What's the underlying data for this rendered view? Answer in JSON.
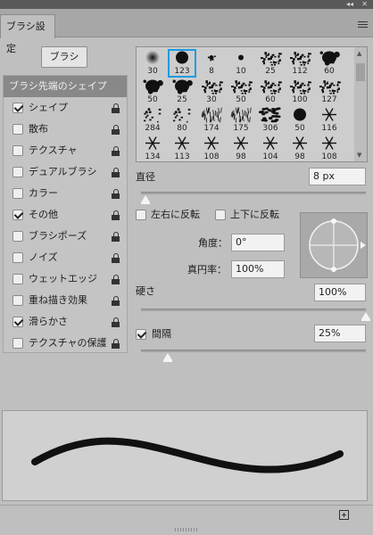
{
  "window": {
    "tab_title": "ブラシ設定",
    "collapse_glyph": "◂◂",
    "close_glyph": "✕"
  },
  "colors": {
    "panel_bg": "#bfbfbf",
    "header_bg": "#888888",
    "selection": "#1e9be0",
    "stroke": "#111111"
  },
  "preset_button": {
    "label": "ブラシ"
  },
  "options": {
    "header": "ブラシ先端のシェイプ",
    "items": [
      {
        "label": "シェイプ",
        "checked": true
      },
      {
        "label": "散布",
        "checked": false
      },
      {
        "label": "テクスチャ",
        "checked": false
      },
      {
        "label": "デュアルブラシ",
        "checked": false
      },
      {
        "label": "カラー",
        "checked": false
      },
      {
        "label": "その他",
        "checked": true
      },
      {
        "label": "ブラシポーズ",
        "checked": false
      },
      {
        "label": "ノイズ",
        "checked": false
      },
      {
        "label": "ウェットエッジ",
        "checked": false
      },
      {
        "label": "重ね描き効果",
        "checked": false
      },
      {
        "label": "滑らかさ",
        "checked": true
      },
      {
        "label": "テクスチャの保護",
        "checked": false
      }
    ]
  },
  "brush_tips": [
    {
      "size": "30",
      "kind": "soft"
    },
    {
      "size": "123",
      "kind": "hard",
      "selected": true
    },
    {
      "size": "8",
      "kind": "splat"
    },
    {
      "size": "10",
      "kind": "dot"
    },
    {
      "size": "25",
      "kind": "spray"
    },
    {
      "size": "112",
      "kind": "rough"
    },
    {
      "size": "60",
      "kind": "blob"
    },
    {
      "size": "50",
      "kind": "blob"
    },
    {
      "size": "25",
      "kind": "blob"
    },
    {
      "size": "30",
      "kind": "chalk"
    },
    {
      "size": "50",
      "kind": "chalk"
    },
    {
      "size": "60",
      "kind": "chalk"
    },
    {
      "size": "100",
      "kind": "rough"
    },
    {
      "size": "127",
      "kind": "chalk"
    },
    {
      "size": "284",
      "kind": "scatter"
    },
    {
      "size": "80",
      "kind": "scatter"
    },
    {
      "size": "174",
      "kind": "grass"
    },
    {
      "size": "175",
      "kind": "grass"
    },
    {
      "size": "306",
      "kind": "leaves"
    },
    {
      "size": "50",
      "kind": "hard"
    },
    {
      "size": "116",
      "kind": "flake"
    },
    {
      "size": "134",
      "kind": "flake"
    },
    {
      "size": "113",
      "kind": "flake"
    },
    {
      "size": "108",
      "kind": "flake"
    },
    {
      "size": "98",
      "kind": "flake"
    },
    {
      "size": "104",
      "kind": "flake"
    },
    {
      "size": "98",
      "kind": "flake"
    },
    {
      "size": "108",
      "kind": "flake"
    }
  ],
  "settings": {
    "size_label": "直径",
    "size_value": "8 px",
    "size_slider_fraction": 0.02,
    "flip_x_label": "左右に反転",
    "flip_x_checked": false,
    "flip_y_label": "上下に反転",
    "flip_y_checked": false,
    "angle_label": "角度：",
    "angle_value": "0°",
    "roundness_label": "真円率：",
    "roundness_value": "100%",
    "hardness_label": "硬さ",
    "hardness_value": "100%",
    "hardness_fraction": 1.0,
    "spacing_label": "間隔",
    "spacing_checked": true,
    "spacing_value": "25%",
    "spacing_fraction": 0.12
  },
  "footer": {
    "new_brush_icon": "new-brush-icon"
  }
}
